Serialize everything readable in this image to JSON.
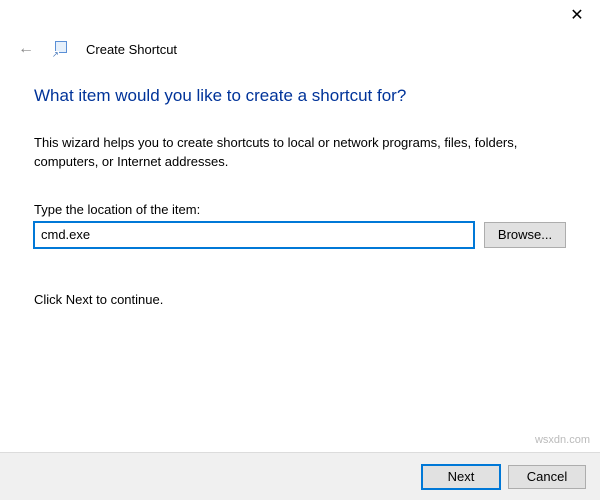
{
  "window": {
    "title": "Create Shortcut"
  },
  "main": {
    "heading": "What item would you like to create a shortcut for?",
    "description": "This wizard helps you to create shortcuts to local or network programs, files, folders, computers, or Internet addresses.",
    "location_label": "Type the location of the item:",
    "location_value": "cmd.exe",
    "browse_label": "Browse...",
    "hint": "Click Next to continue."
  },
  "footer": {
    "next_label": "Next",
    "cancel_label": "Cancel"
  },
  "watermark": "wsxdn.com"
}
